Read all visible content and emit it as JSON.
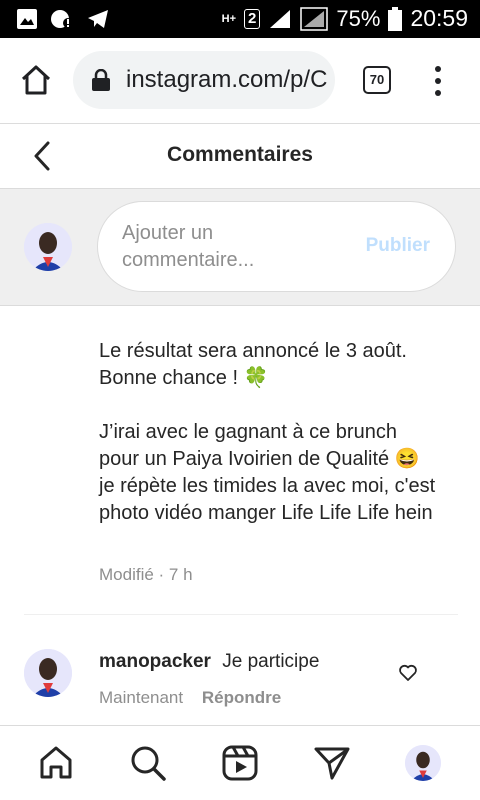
{
  "status_bar": {
    "network": "H+",
    "sim": "2",
    "battery": "75%",
    "time": "20:59"
  },
  "browser": {
    "url": "instagram.com/p/C",
    "tab_count": "70"
  },
  "header": {
    "title": "Commentaires"
  },
  "composer": {
    "placeholder": "Ajouter un commentaire...",
    "publish_label": "Publier"
  },
  "comments": {
    "main": {
      "paragraph1": "Le résultat sera annoncé le 3 août. Bonne chance ! 🍀",
      "paragraph2": "J’irai avec le gagnant à ce brunch pour un Paiya Ivoirien de Qualité 😆 je répète les timides la avec moi, c'est photo vidéo manger Life Life Life hein",
      "meta": "Modifié · 7 h"
    },
    "reply": {
      "username": "manopacker",
      "text": "Je participe",
      "time": "Maintenant",
      "reply_label": "Répondre"
    }
  },
  "icons": {
    "status": [
      "gallery-icon",
      "alert-icon",
      "telegram-icon",
      "signal-icon",
      "battery-icon"
    ],
    "browser": [
      "home-icon",
      "lock-icon",
      "tabs-icon",
      "more-vert-icon"
    ],
    "nav": [
      "home-icon",
      "search-icon",
      "reels-icon",
      "send-icon",
      "profile-avatar"
    ]
  },
  "colors": {
    "publish_disabled": "#c0dffd",
    "text_primary": "#262626",
    "text_secondary": "#8e8e8e",
    "composer_bg": "#efefef"
  }
}
